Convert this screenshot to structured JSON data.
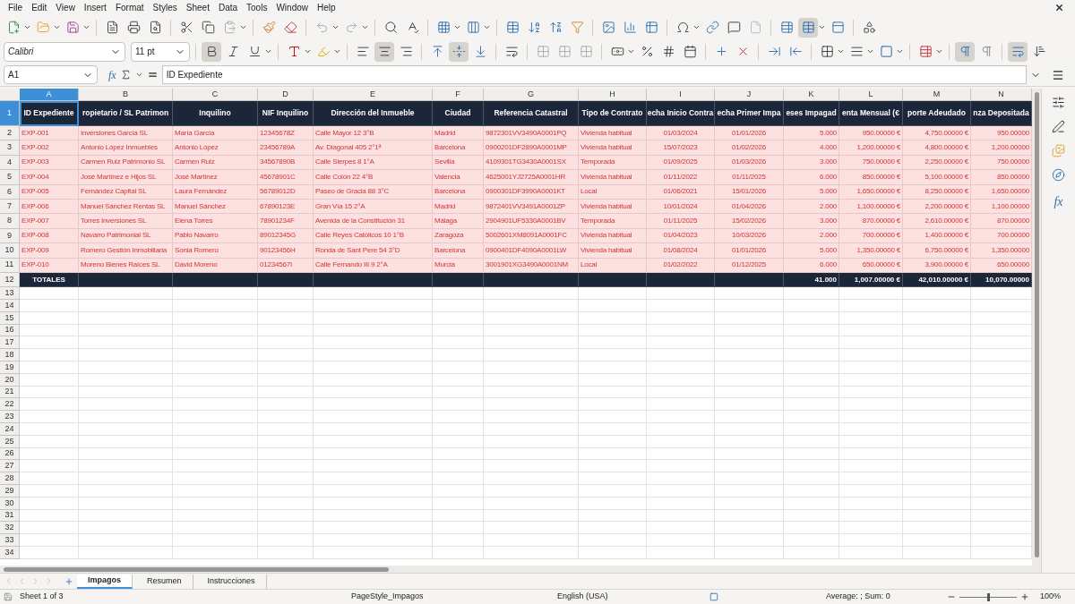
{
  "menu": [
    "File",
    "Edit",
    "View",
    "Insert",
    "Format",
    "Styles",
    "Sheet",
    "Data",
    "Tools",
    "Window",
    "Help"
  ],
  "format_toolbar": {
    "font_name": "Calibri",
    "font_size": "11 pt",
    "bold": true,
    "align_center": true,
    "valign_center": true,
    "ltr": true,
    "wrap_text": true
  },
  "formula_bar": {
    "name_box": "A1",
    "function_label": "fx",
    "content": "ID Expediente"
  },
  "columns": [
    {
      "letter": "A",
      "selected": true,
      "header": "ID Expediente",
      "kind": "text"
    },
    {
      "letter": "B",
      "selected": false,
      "header": "ropietario / SL Patrimon",
      "kind": "text"
    },
    {
      "letter": "C",
      "selected": false,
      "header": "Inquilino",
      "kind": "text"
    },
    {
      "letter": "D",
      "selected": false,
      "header": "NIF Inquilino",
      "kind": "text"
    },
    {
      "letter": "E",
      "selected": false,
      "header": "Dirección del Inmueble",
      "kind": "text"
    },
    {
      "letter": "F",
      "selected": false,
      "header": "Ciudad",
      "kind": "text"
    },
    {
      "letter": "G",
      "selected": false,
      "header": "Referencia Catastral",
      "kind": "text"
    },
    {
      "letter": "H",
      "selected": false,
      "header": "Tipo de Contrato",
      "kind": "text"
    },
    {
      "letter": "I",
      "selected": false,
      "header": "echa Inicio Contra",
      "kind": "date"
    },
    {
      "letter": "J",
      "selected": false,
      "header": "echa Primer Impa",
      "kind": "date"
    },
    {
      "letter": "K",
      "selected": false,
      "header": "eses Impagad",
      "kind": "number"
    },
    {
      "letter": "L",
      "selected": false,
      "header": "enta Mensual (€",
      "kind": "number"
    },
    {
      "letter": "M",
      "selected": false,
      "header": "porte Adeudado",
      "kind": "number"
    },
    {
      "letter": "N",
      "selected": false,
      "header": "nza Depositada",
      "kind": "number"
    }
  ],
  "rows": [
    [
      "EXP-001",
      "Inversiones García SL",
      "María García",
      "12345678Z",
      "Calle Mayor 12 3°B",
      "Madrid",
      "9872301VV3490A0001PQ",
      "Vivienda habitual",
      "01/03/2024",
      "01/01/2026",
      "5.000",
      "950.00000 €",
      "4,750.00000 €",
      "950.00000"
    ],
    [
      "EXP-002",
      "Antonio López Inmuebles",
      "Antonio López",
      "23456789A",
      "Av. Diagonal 405 2°1ª",
      "Barcelona",
      "0900201DF2890A0001MP",
      "Vivienda habitual",
      "15/07/2023",
      "01/02/2026",
      "4.000",
      "1,200.00000 €",
      "4,800.00000 €",
      "1,200.00000"
    ],
    [
      "EXP-003",
      "Carmen Ruiz Patrimonio SL",
      "Carmen Ruiz",
      "34567890B",
      "Calle Sierpes 8 1°A",
      "Sevilla",
      "4109301TG3430A0001SX",
      "Temporada",
      "01/09/2025",
      "01/03/2026",
      "3.000",
      "750.00000 €",
      "2,250.00000 €",
      "750.00000"
    ],
    [
      "EXP-004",
      "José Martínez e Hijos SL",
      "José Martínez",
      "45678901C",
      "Calle Colón 22 4°B",
      "Valencia",
      "4625001YJ2725A0001HR",
      "Vivienda habitual",
      "01/11/2022",
      "01/11/2025",
      "6.000",
      "850.00000 €",
      "5,100.00000 €",
      "850.00000"
    ],
    [
      "EXP-005",
      "Fernández Capital SL",
      "Laura Fernández",
      "56789012D",
      "Paseo de Gracia 88 3°C",
      "Barcelona",
      "0900301DF3990A0001KT",
      "Local",
      "01/06/2021",
      "15/01/2026",
      "5.000",
      "1,650.00000 €",
      "8,250.00000 €",
      "1,650.00000"
    ],
    [
      "EXP-006",
      "Manuel Sánchez Rentas SL",
      "Manuel Sánchez",
      "67890123E",
      "Gran Vía 15 2°A",
      "Madrid",
      "9872401VV3491A0001ZP",
      "Vivienda habitual",
      "10/01/2024",
      "01/04/2026",
      "2.000",
      "1,100.00000 €",
      "2,200.00000 €",
      "1,100.00000"
    ],
    [
      "EXP-007",
      "Torres Inversiones SL",
      "Elena Torres",
      "78901234F",
      "Avenida de la Constitución 31",
      "Málaga",
      "2904901UF5330A0001BV",
      "Temporada",
      "01/11/2025",
      "15/02/2026",
      "3.000",
      "870.00000 €",
      "2,610.00000 €",
      "870.00000"
    ],
    [
      "EXP-008",
      "Navarro Patrimonial SL",
      "Pablo Navarro",
      "89012345G",
      "Calle Reyes Católicos 10 1°B",
      "Zaragoza",
      "5002601XM8091A0001FC",
      "Vivienda habitual",
      "01/04/2023",
      "10/03/2026",
      "2.000",
      "700.00000 €",
      "1,400.00000 €",
      "700.00000"
    ],
    [
      "EXP-009",
      "Romero Gestión Inmobiliaria",
      "Sonia Romero",
      "90123456H",
      "Ronda de Sant Pere 54 3°D",
      "Barcelona",
      "0900401DF4090A0001LW",
      "Vivienda habitual",
      "01/08/2024",
      "01/01/2026",
      "5.000",
      "1,350.00000 €",
      "6,750.00000 €",
      "1,350.00000"
    ],
    [
      "EXP-010",
      "Moreno Bienes Raíces SL",
      "David Moreno",
      "01234567I",
      "Calle Fernando III 9 2°A",
      "Murcia",
      "3001901XG3490A0001NM",
      "Local",
      "01/02/2022",
      "01/12/2025",
      "6.000",
      "650.00000 €",
      "3,900.00000 €",
      "650.00000"
    ]
  ],
  "totals": {
    "A": "TOTALES",
    "K": "41.000",
    "L": "1,007.00000 €",
    "M": "42,010.00000 €",
    "N": "10,070.00000"
  },
  "row_headers": [
    {
      "label": "1",
      "selected": true
    },
    {
      "label": "2",
      "selected": false
    },
    {
      "label": "3",
      "selected": false
    },
    {
      "label": "4",
      "selected": false
    },
    {
      "label": "5",
      "selected": false
    },
    {
      "label": "6",
      "selected": false
    },
    {
      "label": "7",
      "selected": false
    },
    {
      "label": "8",
      "selected": false
    },
    {
      "label": "9",
      "selected": false
    },
    {
      "label": "10",
      "selected": false
    },
    {
      "label": "11",
      "selected": false
    },
    {
      "label": "12",
      "selected": false
    },
    {
      "label": "13",
      "selected": false
    },
    {
      "label": "14",
      "selected": false
    },
    {
      "label": "15",
      "selected": false
    },
    {
      "label": "16",
      "selected": false
    },
    {
      "label": "17",
      "selected": false
    },
    {
      "label": "18",
      "selected": false
    },
    {
      "label": "19",
      "selected": false
    },
    {
      "label": "20",
      "selected": false
    },
    {
      "label": "21",
      "selected": false
    },
    {
      "label": "22",
      "selected": false
    },
    {
      "label": "23",
      "selected": false
    },
    {
      "label": "24",
      "selected": false
    },
    {
      "label": "25",
      "selected": false
    },
    {
      "label": "26",
      "selected": false
    },
    {
      "label": "27",
      "selected": false
    },
    {
      "label": "28",
      "selected": false
    },
    {
      "label": "29",
      "selected": false
    },
    {
      "label": "30",
      "selected": false
    },
    {
      "label": "31",
      "selected": false
    },
    {
      "label": "32",
      "selected": false
    },
    {
      "label": "33",
      "selected": false
    },
    {
      "label": "34",
      "selected": false
    }
  ],
  "sheet_tabs": [
    {
      "label": "Impagos",
      "selected": true
    },
    {
      "label": "Resumen",
      "selected": false
    },
    {
      "label": "Instrucciones",
      "selected": false
    }
  ],
  "sidebar": {
    "function_label": "fx"
  },
  "status_bar": {
    "sheet": "Sheet 1 of 3",
    "page_style": "PageStyle_Impagos",
    "language": "English (USA)",
    "summary": "Average: ; Sum: 0",
    "zoom": {
      "level": 0.5,
      "reading": "100%"
    }
  }
}
